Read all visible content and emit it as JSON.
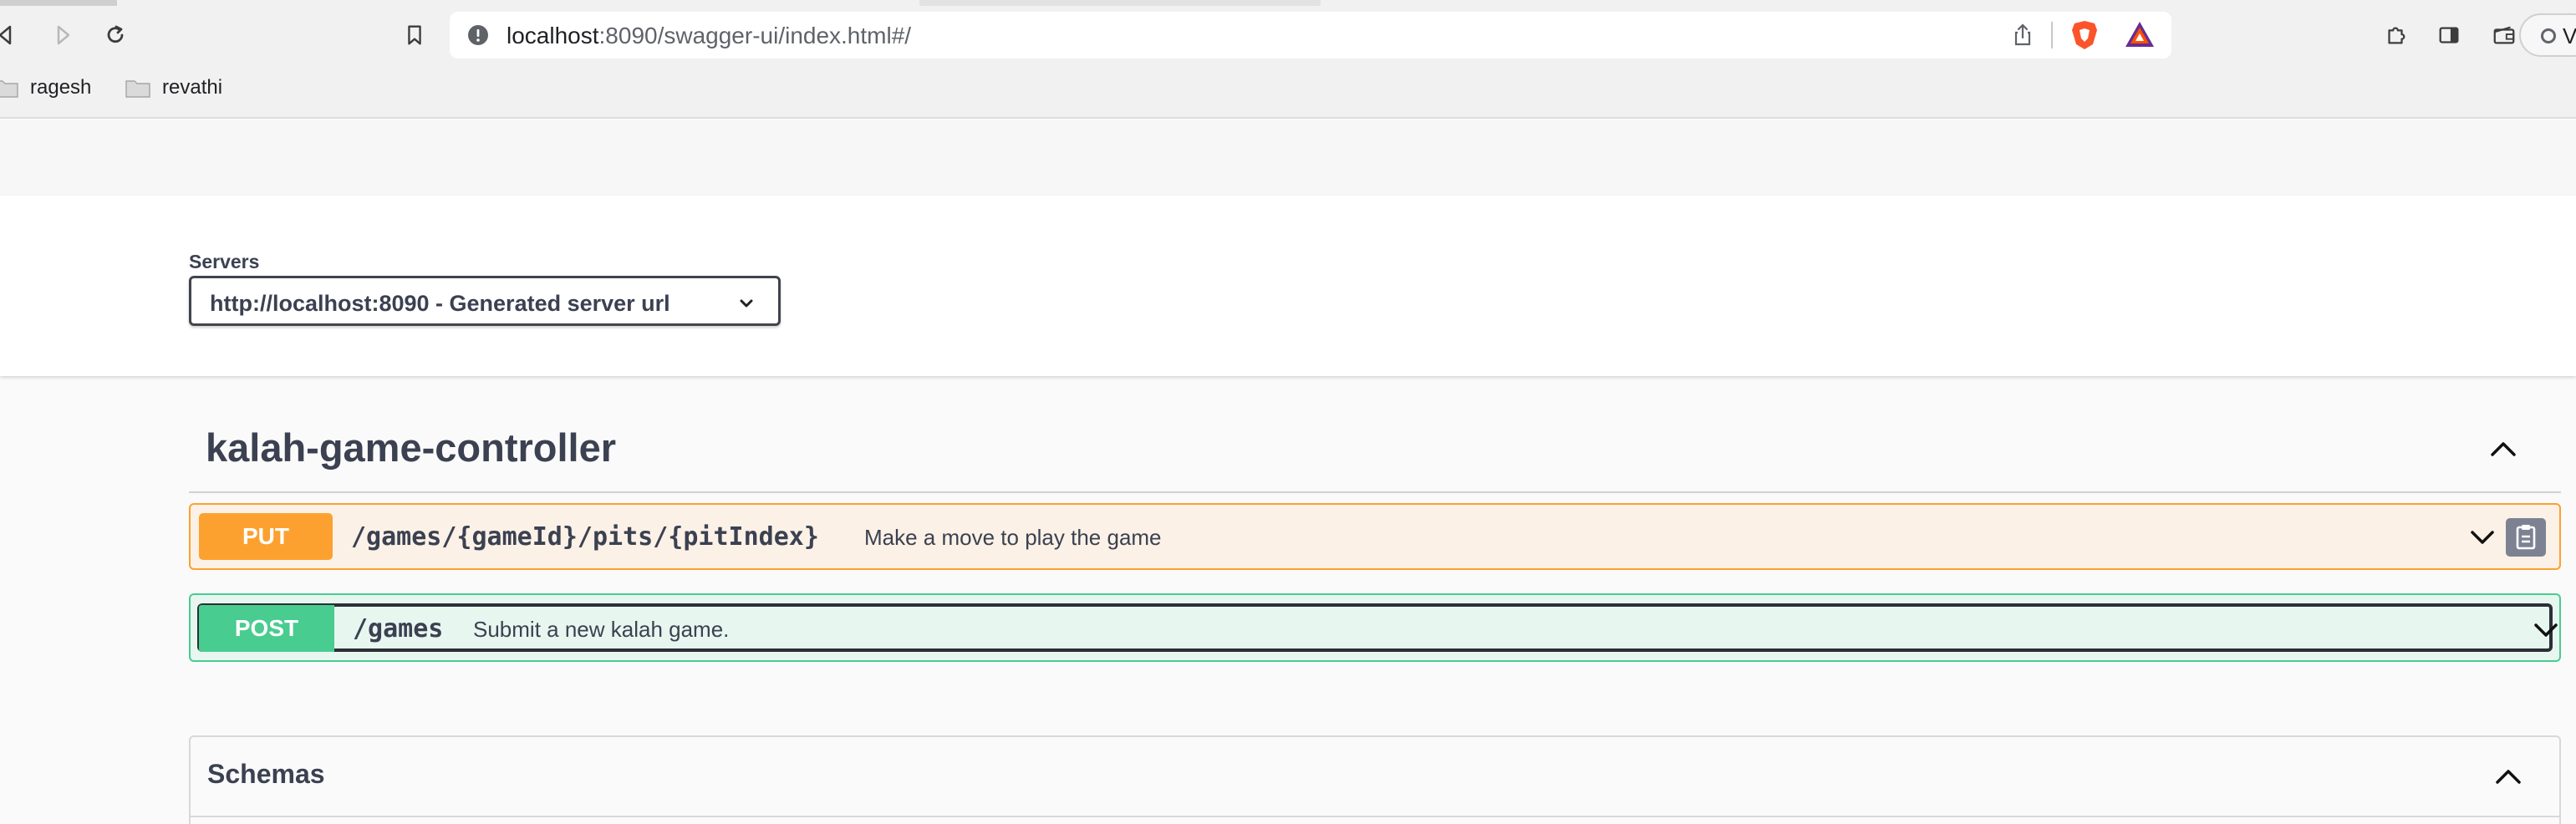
{
  "browser": {
    "url_host": "localhost",
    "url_path": ":8090/swagger-ui/index.html#/",
    "bookmarks": [
      {
        "label": "ragesh"
      },
      {
        "label": "revathi"
      }
    ],
    "profile_initial": "V"
  },
  "servers": {
    "label": "Servers",
    "selected": "http://localhost:8090 - Generated server url"
  },
  "tag": {
    "title": "kalah-game-controller"
  },
  "operations": [
    {
      "method": "PUT",
      "path": "/games/{gameId}/pits/{pitIndex}",
      "summary": "Make a move to play the game",
      "color": "#fca130"
    },
    {
      "method": "POST",
      "path": "/games",
      "summary": "Submit a new kalah game.",
      "color": "#49cc90"
    }
  ],
  "schemas": {
    "title": "Schemas"
  },
  "icons": [
    "back-icon",
    "forward-icon",
    "reload-icon",
    "bookmark-icon",
    "site-info-icon",
    "share-icon",
    "brave-shields-icon",
    "brave-rewards-icon",
    "extensions-icon",
    "sidebar-icon",
    "wallet-icon",
    "folder-icon",
    "chevron-down-icon",
    "chevron-up-icon",
    "copy-icon"
  ]
}
